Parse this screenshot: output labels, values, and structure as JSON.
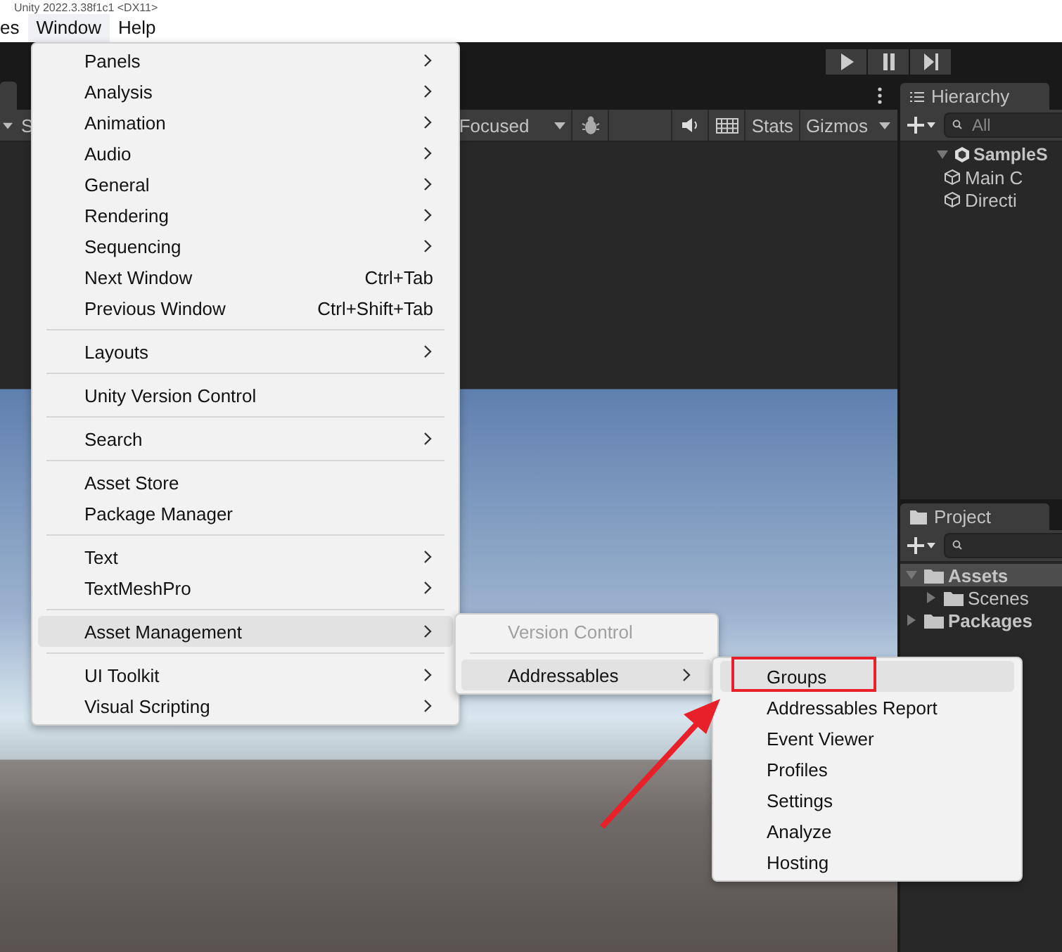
{
  "window": {
    "title": "Unity 2022.3.38f1c1 <DX11>"
  },
  "menu_bar": [
    {
      "label": "es",
      "selected": false
    },
    {
      "label": "Window",
      "selected": true
    },
    {
      "label": "Help",
      "selected": false
    }
  ],
  "scene_toolbar": {
    "left_text": "S",
    "camera_mode": "Focused",
    "buttons": [
      "Stats",
      "Gizmos"
    ]
  },
  "hierarchy": {
    "title": "Hierarchy",
    "search_placeholder": "All",
    "items": [
      {
        "label": "SampleS",
        "kind": "scene",
        "expanded": true,
        "children": [
          {
            "label": "Main C",
            "kind": "object"
          },
          {
            "label": "Directi",
            "kind": "object"
          }
        ]
      }
    ]
  },
  "project": {
    "title": "Project",
    "tree": [
      {
        "label": "Assets",
        "selected": true,
        "expanded": true,
        "children": [
          {
            "label": "Scenes",
            "selected": false,
            "expanded": false
          }
        ]
      },
      {
        "label": "Packages",
        "selected": false,
        "expanded": false
      }
    ]
  },
  "window_menu": {
    "items": [
      {
        "kind": "item",
        "label": "Panels",
        "has_submenu": true,
        "selected": false
      },
      {
        "kind": "item",
        "label": "Analysis",
        "has_submenu": true,
        "selected": false
      },
      {
        "kind": "item",
        "label": "Animation",
        "has_submenu": true,
        "selected": false
      },
      {
        "kind": "item",
        "label": "Audio",
        "has_submenu": true,
        "selected": false
      },
      {
        "kind": "item",
        "label": "General",
        "has_submenu": true,
        "selected": false
      },
      {
        "kind": "item",
        "label": "Rendering",
        "has_submenu": true,
        "selected": false
      },
      {
        "kind": "item",
        "label": "Sequencing",
        "has_submenu": true,
        "selected": false
      },
      {
        "kind": "item",
        "label": "Next Window",
        "shortcut": "Ctrl+Tab",
        "has_submenu": false,
        "selected": false
      },
      {
        "kind": "item",
        "label": "Previous Window",
        "shortcut": "Ctrl+Shift+Tab",
        "has_submenu": false,
        "selected": false
      },
      {
        "kind": "separator"
      },
      {
        "kind": "item",
        "label": "Layouts",
        "has_submenu": true,
        "selected": false
      },
      {
        "kind": "separator"
      },
      {
        "kind": "item",
        "label": "Unity Version Control",
        "has_submenu": false,
        "selected": false
      },
      {
        "kind": "separator"
      },
      {
        "kind": "item",
        "label": "Search",
        "has_submenu": true,
        "selected": false
      },
      {
        "kind": "separator"
      },
      {
        "kind": "item",
        "label": "Asset Store",
        "has_submenu": false,
        "selected": false
      },
      {
        "kind": "item",
        "label": "Package Manager",
        "has_submenu": false,
        "selected": false
      },
      {
        "kind": "separator"
      },
      {
        "kind": "item",
        "label": "Text",
        "has_submenu": true,
        "selected": false
      },
      {
        "kind": "item",
        "label": "TextMeshPro",
        "has_submenu": true,
        "selected": false
      },
      {
        "kind": "separator"
      },
      {
        "kind": "item",
        "label": "Asset Management",
        "has_submenu": true,
        "selected": true
      },
      {
        "kind": "separator"
      },
      {
        "kind": "item",
        "label": "UI Toolkit",
        "has_submenu": true,
        "selected": false
      },
      {
        "kind": "item",
        "label": "Visual Scripting",
        "has_submenu": true,
        "selected": false
      }
    ]
  },
  "asset_management_menu": {
    "items": [
      {
        "kind": "item",
        "label": "Version Control",
        "has_submenu": false,
        "disabled": true,
        "selected": false
      },
      {
        "kind": "separator"
      },
      {
        "kind": "item",
        "label": "Addressables",
        "has_submenu": true,
        "disabled": false,
        "selected": true
      }
    ]
  },
  "addressables_menu": {
    "items": [
      {
        "label": "Groups",
        "selected": true
      },
      {
        "label": "Addressables Report",
        "selected": false
      },
      {
        "label": "Event Viewer",
        "selected": false
      },
      {
        "label": "Profiles",
        "selected": false
      },
      {
        "label": "Settings",
        "selected": false
      },
      {
        "label": "Analyze",
        "selected": false
      },
      {
        "label": "Hosting",
        "selected": false
      }
    ]
  }
}
